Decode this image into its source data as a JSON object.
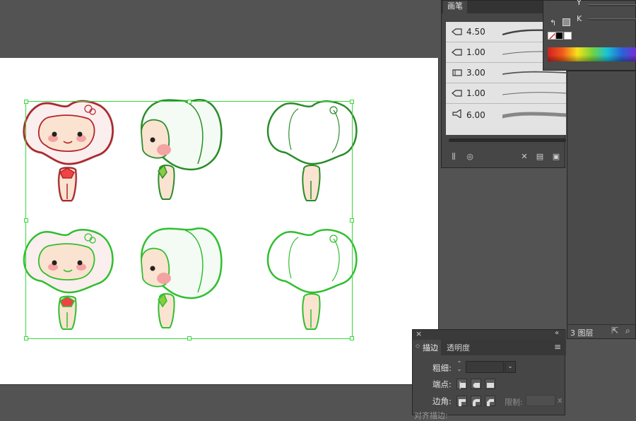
{
  "brushes_panel": {
    "tab": "画笔",
    "brushes": [
      {
        "value": "4.50",
        "icon": "calligraphic-brush-icon"
      },
      {
        "value": "1.00",
        "icon": "calligraphic-brush-icon"
      },
      {
        "value": "3.00",
        "icon": "art-brush-icon"
      },
      {
        "value": "1.00",
        "icon": "calligraphic-brush-icon"
      },
      {
        "value": "6.00",
        "icon": "bristle-brush-icon"
      }
    ]
  },
  "color_panel": {
    "y_label": "Y",
    "k_label": "K",
    "spectrum_colors": [
      "#d12121",
      "#f7e21c",
      "#19c3d8",
      "#7a2ad6"
    ]
  },
  "layers_panel": {
    "count_label": "3 图层"
  },
  "stroke_panel": {
    "tab_stroke": "描边",
    "tab_transparency": "透明度",
    "weight_label": "粗细:",
    "cap_label": "端点:",
    "corner_label": "边角:",
    "limit_label": "限制:",
    "limit_suffix": "x",
    "align_label": "对齐描边:"
  },
  "artwork": {
    "selection_color": "#39d739",
    "figures": 6
  }
}
